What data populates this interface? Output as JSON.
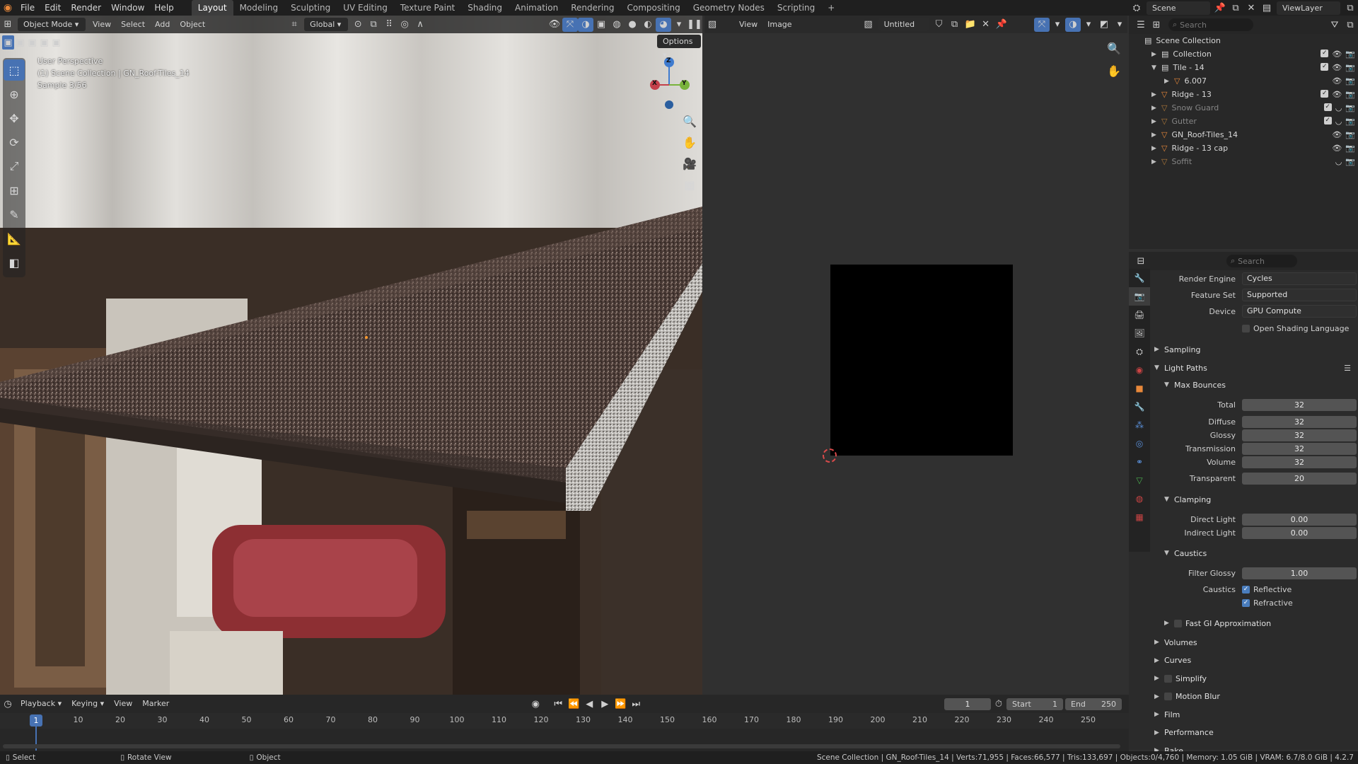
{
  "menu": {
    "items": [
      "File",
      "Edit",
      "Render",
      "Window",
      "Help"
    ],
    "workspaces": [
      "Layout",
      "Modeling",
      "Sculpting",
      "UV Editing",
      "Texture Paint",
      "Shading",
      "Animation",
      "Rendering",
      "Compositing",
      "Geometry Nodes",
      "Scripting"
    ],
    "active_workspace": "Layout",
    "add_tab": "+",
    "scene": "Scene",
    "view_layer": "ViewLayer"
  },
  "viewport": {
    "mode": "Object Mode",
    "menus": [
      "View",
      "Select",
      "Add",
      "Object"
    ],
    "transform_orientation": "Global",
    "options": "Options",
    "overlay_lines": [
      "User Perspective",
      "(1) Scene Collection | GN_Roof-Tiles_14",
      "Sample 3/56"
    ],
    "gizmo_axes": [
      "Z",
      "Y",
      "X"
    ]
  },
  "image_editor": {
    "menus": [
      "View",
      "Image"
    ],
    "image_name": "Untitled"
  },
  "outliner": {
    "search_placeholder": "Search",
    "root": "Scene Collection",
    "rows": [
      {
        "name": "Collection",
        "dim": false
      },
      {
        "name": "Tile - 14",
        "dim": false
      },
      {
        "name": "6.007",
        "dim": false
      },
      {
        "name": "Ridge - 13",
        "dim": false
      },
      {
        "name": "Snow Guard",
        "dim": true
      },
      {
        "name": "Gutter",
        "dim": true
      },
      {
        "name": "GN_Roof-Tiles_14",
        "dim": false
      },
      {
        "name": "Ridge - 13 cap",
        "dim": false
      },
      {
        "name": "Soffit",
        "dim": true
      }
    ]
  },
  "properties": {
    "search_placeholder": "Search",
    "render_engine_label": "Render Engine",
    "render_engine": "Cycles",
    "feature_set_label": "Feature Set",
    "feature_set": "Supported",
    "device_label": "Device",
    "device": "GPU Compute",
    "osl_label": "Open Shading Language",
    "sampling": "Sampling",
    "light_paths": "Light Paths",
    "max_bounces": "Max Bounces",
    "bounces": [
      {
        "label": "Total",
        "value": "32"
      },
      {
        "label": "Diffuse",
        "value": "32"
      },
      {
        "label": "Glossy",
        "value": "32"
      },
      {
        "label": "Transmission",
        "value": "32"
      },
      {
        "label": "Volume",
        "value": "32"
      },
      {
        "label": "Transparent",
        "value": "20"
      }
    ],
    "clamping": "Clamping",
    "direct_light_label": "Direct Light",
    "direct_light": "0.00",
    "indirect_light_label": "Indirect Light",
    "indirect_light": "0.00",
    "caustics_head": "Caustics",
    "filter_glossy_label": "Filter Glossy",
    "filter_glossy": "1.00",
    "caustics_label": "Caustics",
    "reflective": "Reflective",
    "refractive": "Refractive",
    "fast_gi": "Fast GI Approximation",
    "collapsed": [
      "Volumes",
      "Curves",
      "Simplify",
      "Motion Blur",
      "Film",
      "Performance",
      "Bake"
    ]
  },
  "timeline": {
    "menus": [
      "Playback",
      "Keying",
      "View",
      "Marker"
    ],
    "current_frame": "1",
    "start_label": "Start",
    "start": "1",
    "end_label": "End",
    "end": "250",
    "ticks": [
      "10",
      "20",
      "30",
      "40",
      "50",
      "60",
      "70",
      "80",
      "90",
      "100",
      "110",
      "120",
      "130",
      "140",
      "150",
      "160",
      "170",
      "180",
      "190",
      "200",
      "210",
      "220",
      "230",
      "240",
      "250"
    ]
  },
  "status": {
    "select": "Select",
    "rotate": "Rotate View",
    "object": "Object",
    "info": "Scene Collection | GN_Roof-Tiles_14 | Verts:71,955 | Faces:66,577 | Tris:133,697 | Objects:0/4,760 | Memory: 1.05 GiB | VRAM: 6.7/8.0 GiB | 4.2.7"
  },
  "colors": {
    "accent": "#4772b3",
    "x_axis": "#c4404a",
    "y_axis": "#79b33b",
    "z_axis": "#3e7bcf"
  }
}
